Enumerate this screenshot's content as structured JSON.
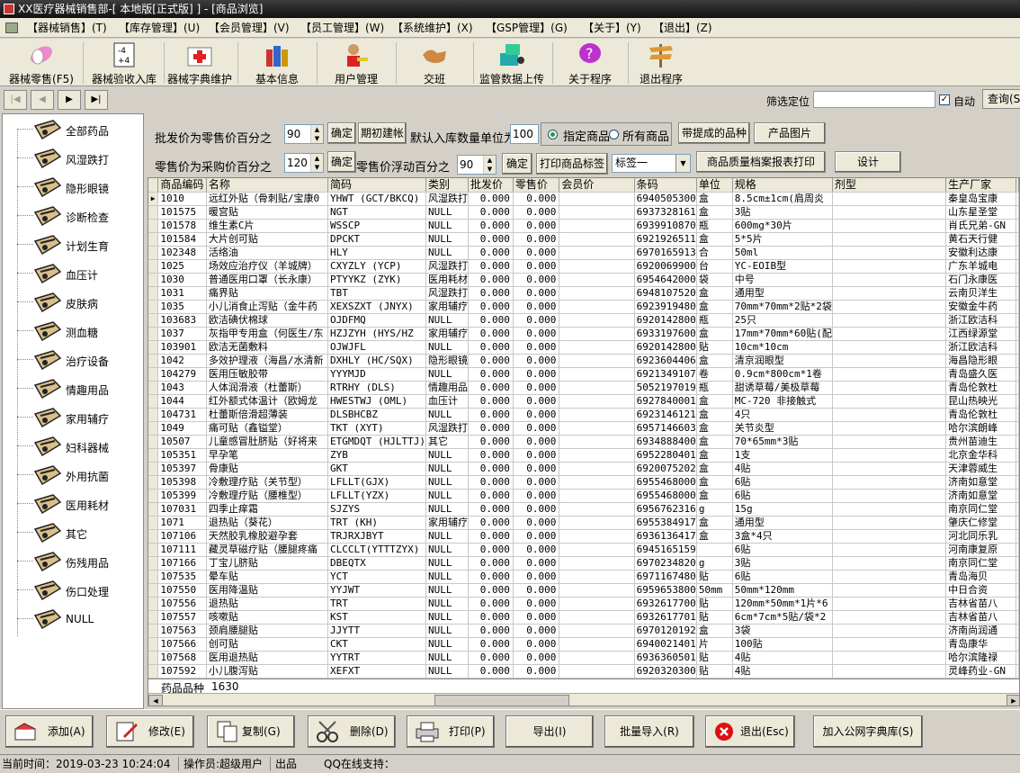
{
  "window": {
    "title": "XX医疗器械销售部-[ 本地版[正式版] ] - [商品浏览]"
  },
  "menu": [
    "【器械销售】(T)",
    "【库存管理】(U)",
    "【会员管理】(V)",
    "【员工管理】(W)",
    "【系统维护】(X)",
    "【GSP管理】(G)",
    "【关于】(Y)",
    "【退出】(Z)"
  ],
  "toolbar": {
    "items": [
      {
        "label": "器械零售(F5)",
        "icon": "pills-icon"
      },
      {
        "label": "器械验收入库",
        "icon": "calculator-icon"
      },
      {
        "label": "器械字典维护",
        "icon": "first-aid-icon"
      },
      {
        "label": "基本信息",
        "icon": "bottles-icon"
      },
      {
        "label": "用户管理",
        "icon": "user-keys-icon"
      },
      {
        "label": "交班",
        "icon": "handshake-icon"
      },
      {
        "label": "监管数据上传",
        "icon": "upload-icon"
      },
      {
        "label": "关于程序",
        "icon": "help-icon"
      },
      {
        "label": "退出程序",
        "icon": "exit-sign-icon"
      }
    ]
  },
  "nav": {
    "first": "|◀",
    "prev": "◀",
    "next": "▶",
    "last": "▶|",
    "filter_label": "筛选定位",
    "filter_value": "",
    "auto_label": "自动",
    "auto_checked": true,
    "query_label": "查询(S)"
  },
  "sidebar": {
    "items": [
      "全部药品",
      "风湿跌打",
      "隐形眼镜",
      "诊断检查",
      "计划生育",
      "血压计",
      "皮肤病",
      "测血糖",
      "治疗设备",
      "情趣用品",
      "家用辅疗",
      "妇科器械",
      "外用抗菌",
      "医用耗材",
      "其它",
      "伤残用品",
      "伤口处理",
      "NULL"
    ]
  },
  "controls": {
    "wholesale_pct_label": "批发价为零售价百分之",
    "wholesale_pct_value": "90",
    "confirm1": "确定",
    "period_btn": "期初建帐",
    "default_qty_label": "默认入库数量单位为",
    "default_qty_value": "100",
    "radio_specified": "指定商品",
    "radio_all": "所有商品",
    "with_ext_btn": "带提成的品种",
    "product_img_btn": "产品图片",
    "retail_pct_label": "零售价为采购价百分之",
    "retail_pct_value": "120",
    "confirm2": "确定",
    "float_label": "零售价浮动百分之",
    "float_value": "90",
    "confirm3": "确定",
    "print_label_btn": "打印商品标签",
    "tag_select": "标签一",
    "quality_btn": "商品质量档案报表打印",
    "design_btn": "设计"
  },
  "grid": {
    "columns": [
      "商品编码",
      "名称",
      "简码",
      "类别",
      "批发价",
      "零售价",
      "会员价",
      "条码",
      "单位",
      "规格",
      "剂型",
      "生产厂家"
    ],
    "rows": [
      [
        "1010",
        "远红外贴（骨刺贴/宝康0",
        "YHWT (GCT/BKCQ)",
        "风湿跌打",
        "0.000",
        "0.000",
        "",
        "6940505300",
        "盒",
        "8.5cm±1cm(肩周炎",
        "",
        "秦皇岛宝康"
      ],
      [
        "101575",
        "暖宫贴",
        "NGT",
        "NULL",
        "0.000",
        "0.000",
        "",
        "6937328161",
        "盒",
        "3贴",
        "",
        "山东星圣堂"
      ],
      [
        "101578",
        "维生素C片",
        "WSSCP",
        "NULL",
        "0.000",
        "0.000",
        "",
        "6939910870",
        "瓶",
        "600mg*30片",
        "",
        "肖氏兄弟-GN"
      ],
      [
        "101584",
        "大片创可贴",
        "DPCKT",
        "NULL",
        "0.000",
        "0.000",
        "",
        "6921926511",
        "盒",
        "5*5片",
        "",
        "黄石天行健"
      ],
      [
        "102348",
        "活络油",
        "HLY",
        "NULL",
        "0.000",
        "0.000",
        "",
        "6970165913",
        "合",
        "50ml",
        "",
        "安徽利达康"
      ],
      [
        "1025",
        "场效应治疗仪（羊城牌）",
        "CXYZLY (YCP)",
        "风湿跌打",
        "0.000",
        "0.000",
        "",
        "6920069900",
        "台",
        "YC-EOIB型",
        "",
        "广东羊城电"
      ],
      [
        "1030",
        "普通医用口罩（长永康）",
        "PTYYKZ (ZYK)",
        "医用耗材",
        "0.000",
        "0.000",
        "",
        "6954642000",
        "袋",
        "中号",
        "",
        "石门永康医"
      ],
      [
        "1031",
        "痛界贴",
        "TBT",
        "风湿跌打",
        "0.000",
        "0.000",
        "",
        "6948107520",
        "盒",
        "通用型",
        "",
        "云南贝洋生"
      ],
      [
        "1035",
        "小儿消食止泻贴（金牛药",
        "XEXSZXT (JNYX)",
        "家用辅疗",
        "0.000",
        "0.000",
        "",
        "6923919480",
        "盒",
        "70mm*70mm*2贴*2袋",
        "",
        "安徽金牛药"
      ],
      [
        "103683",
        "欧洁碘伏棉球",
        "OJDFMQ",
        "NULL",
        "0.000",
        "0.000",
        "",
        "6920142800",
        "瓶",
        "25只",
        "",
        "浙江欧洁科"
      ],
      [
        "1037",
        "灰指甲专用盒（何医生/东",
        "HZJZYH (HYS/HZ",
        "家用辅疗",
        "0.000",
        "0.000",
        "",
        "6933197600",
        "盒",
        "17mm*70mm*60贴(配",
        "",
        "江西绿源堂"
      ],
      [
        "103901",
        "欧洁无菌敷料",
        "OJWJFL",
        "NULL",
        "0.000",
        "0.000",
        "",
        "6920142800",
        "贴",
        "10cm*10cm",
        "",
        "浙江欧洁科"
      ],
      [
        "1042",
        "多效护理液（海昌/水清新",
        "DXHLY (HC/SQX)",
        "隐形眼镜",
        "0.000",
        "0.000",
        "",
        "6923604406",
        "盒",
        "清京润眼型",
        "",
        "海昌隐形眼"
      ],
      [
        "104279",
        "医用压敏胶带",
        "YYYMJD",
        "NULL",
        "0.000",
        "0.000",
        "",
        "6921349107",
        "卷",
        "0.9cm*800cm*1卷",
        "",
        "青岛盛久医"
      ],
      [
        "1043",
        "人体润滑液（杜蕾斯）",
        "RTRHY (DLS)",
        "情趣用品",
        "0.000",
        "0.000",
        "",
        "5052197019",
        "瓶",
        "甜诱草莓/美极草莓",
        "",
        "青岛伦敦杜"
      ],
      [
        "1044",
        "红外额式体温计（欧姆龙",
        "HWESTWJ (OML)",
        "血压计",
        "0.000",
        "0.000",
        "",
        "6927840001",
        "盒",
        "MC-720 非接触式",
        "",
        "昆山热映光"
      ],
      [
        "104731",
        "杜蕾斯倍滑超薄装",
        "DLSBHCBZ",
        "NULL",
        "0.000",
        "0.000",
        "",
        "6923146121",
        "盒",
        "4只",
        "",
        "青岛伦敦杜"
      ],
      [
        "1049",
        "痛可贴（鑫镒堂）",
        "TKT (XYT)",
        "风湿跌打",
        "0.000",
        "0.000",
        "",
        "6957146603",
        "盒",
        "关节炎型",
        "",
        "哈尔滨朗峰"
      ],
      [
        "10507",
        "儿童感冒肚脐贴（好将来",
        "ETGMDQT (HJLTTJ)",
        "其它",
        "0.000",
        "0.000",
        "",
        "6934888400",
        "盒",
        "70*65mm*3贴",
        "",
        "贵州苗迪生"
      ],
      [
        "105351",
        "早孕笔",
        "ZYB",
        "NULL",
        "0.000",
        "0.000",
        "",
        "6952280401",
        "盒",
        "1支",
        "",
        "北京金华科"
      ],
      [
        "105397",
        "骨康贴",
        "GKT",
        "NULL",
        "0.000",
        "0.000",
        "",
        "6920075202",
        "盒",
        "4贴",
        "",
        "天津蓉威生"
      ],
      [
        "105398",
        "冷敷理疗贴（关节型）",
        "LFLLT(GJX)",
        "NULL",
        "0.000",
        "0.000",
        "",
        "6955468000",
        "盒",
        "6贴",
        "",
        "济南如意堂"
      ],
      [
        "105399",
        "冷敷理疗贴（腰椎型）",
        "LFLLT(YZX)",
        "NULL",
        "0.000",
        "0.000",
        "",
        "6955468000",
        "盒",
        "6贴",
        "",
        "济南如意堂"
      ],
      [
        "107031",
        "四季止痒霜",
        "SJZYS",
        "NULL",
        "0.000",
        "0.000",
        "",
        "6956762316",
        "g",
        "15g",
        "",
        "南京同仁堂"
      ],
      [
        "1071",
        "退热贴（葵花）",
        "TRT (KH)",
        "家用辅疗",
        "0.000",
        "0.000",
        "",
        "6955384917",
        "盒",
        "通用型",
        "",
        "肇庆仁修堂"
      ],
      [
        "107106",
        "天然胶乳橡胶避孕套",
        "TRJRXJBYT",
        "NULL",
        "0.000",
        "0.000",
        "",
        "6936136417",
        "盒",
        "3盒*4只",
        "",
        "河北同乐乳"
      ],
      [
        "107111",
        "藏灵草磁疗贴（腰腿疼痛",
        "CLCCLT(YTTTZYX)",
        "NULL",
        "0.000",
        "0.000",
        "",
        "6945165159",
        "",
        "6贴",
        "",
        "河南康复原"
      ],
      [
        "107166",
        "丁宝儿脐贴",
        "DBEQTX",
        "NULL",
        "0.000",
        "0.000",
        "",
        "6970234820",
        "g",
        "3贴",
        "",
        "南京同仁堂"
      ],
      [
        "107535",
        "晕车贴",
        "YCT",
        "NULL",
        "0.000",
        "0.000",
        "",
        "6971167480",
        "贴",
        "6贴",
        "",
        "青岛海贝"
      ],
      [
        "107550",
        "医用降温贴",
        "YYJWT",
        "NULL",
        "0.000",
        "0.000",
        "",
        "6959653800",
        "50mm",
        "50mm*120mm",
        "",
        "中日合资"
      ],
      [
        "107556",
        "退热贴",
        "TRT",
        "NULL",
        "0.000",
        "0.000",
        "",
        "6932617700",
        "贴",
        "120mm*50mm*1片*6",
        "",
        "吉林省苗八"
      ],
      [
        "107557",
        "咳嗽贴",
        "KST",
        "NULL",
        "0.000",
        "0.000",
        "",
        "6932617701",
        "贴",
        "6cm*7cm*5贴/袋*2",
        "",
        "吉林省苗八"
      ],
      [
        "107563",
        "颈肩腰腿贴",
        "JJYTT",
        "NULL",
        "0.000",
        "0.000",
        "",
        "6970120192",
        "盒",
        "3袋",
        "",
        "济南尚润通"
      ],
      [
        "107566",
        "创可贴",
        "CKT",
        "NULL",
        "0.000",
        "0.000",
        "",
        "6940021401",
        "片",
        "100贴",
        "",
        "青岛康华"
      ],
      [
        "107568",
        "医用退热贴",
        "YYTRT",
        "NULL",
        "0.000",
        "0.000",
        "",
        "6936360501",
        "贴",
        "4贴",
        "",
        "哈尔滨隆禄"
      ],
      [
        "107592",
        "小儿腹泻贴",
        "XEFXT",
        "NULL",
        "0.000",
        "0.000",
        "",
        "6920320300",
        "贴",
        "4贴",
        "",
        "灵峰药业-GN"
      ]
    ],
    "footer_label": "药品品种",
    "footer_count": "1630"
  },
  "actions": [
    {
      "label": "添加(A)",
      "icon": "add-icon"
    },
    {
      "label": "修改(E)",
      "icon": "edit-icon"
    },
    {
      "label": "复制(G)",
      "icon": "copy-icon"
    },
    {
      "label": "删除(D)",
      "icon": "scissors-icon"
    },
    {
      "label": "打印(P)",
      "icon": "printer-icon"
    },
    {
      "label": "导出(I)",
      "icon": ""
    },
    {
      "label": "批量导入(R)",
      "icon": ""
    },
    {
      "label": "退出(Esc)",
      "icon": "close-icon"
    },
    {
      "label": "加入公网字典库(S)",
      "icon": ""
    }
  ],
  "status": {
    "time": "当前时间：2019-03-23 10:24:04",
    "operator": "操作员:超级用户",
    "mode": "出品",
    "qq": "QQ在线支持："
  }
}
